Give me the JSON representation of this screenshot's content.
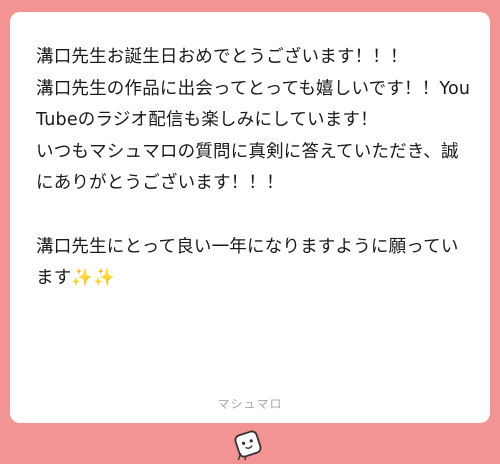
{
  "card": {
    "message": "溝口先生お誕生日おめでとうございます！！！\n溝口先生の作品に出会ってとっても嬉しいです！！YouTubeのラジオ配信も楽しみにしています！\nいつもマシュマロの質問に真剣に答えていただき、誠にありがとうございます！！！\n\n溝口先生にとって良い一年になりますように願っています✨✨",
    "footer_brand": "マシュマロ"
  },
  "mascot": {
    "icon": "marshmallow-mascot-icon"
  },
  "colors": {
    "background": "#f29494",
    "card": "#ffffff",
    "text": "#1a1a1a",
    "footer_text": "#a8a8a8"
  }
}
